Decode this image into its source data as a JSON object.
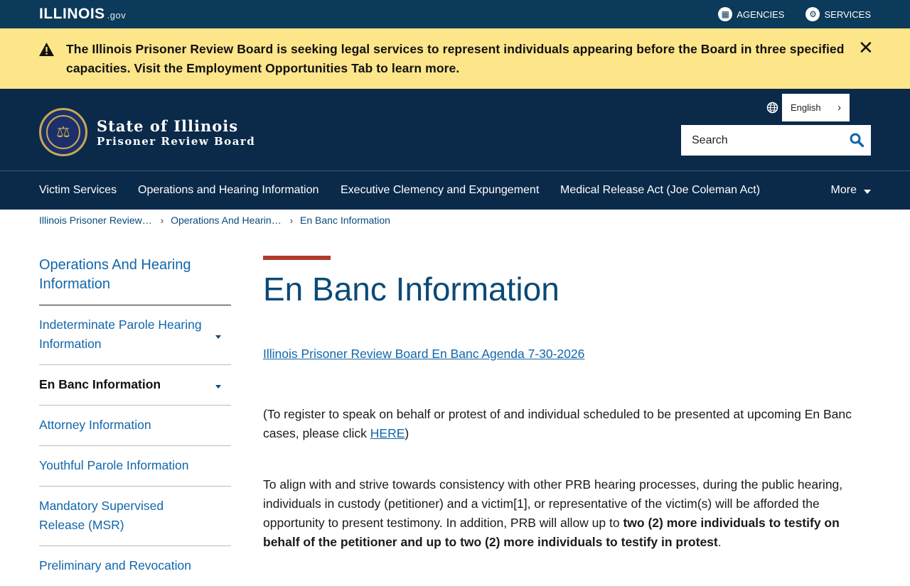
{
  "gov_bar": {
    "logo_text": "ILLINOIS",
    "logo_suffix": ".gov",
    "agencies_label": "AGENCIES",
    "services_label": "SERVICES"
  },
  "alert": {
    "message": "The Illinois Prisoner Review Board is seeking legal services to represent individuals appearing before the Board in three specified capacities.  Visit the Employment Opportunities Tab to learn more.",
    "close_glyph": "✕"
  },
  "header": {
    "brand_line1": "State of Illinois",
    "brand_line2": "Prisoner Review Board",
    "language": "English",
    "search_placeholder": "Search"
  },
  "nav": {
    "items": [
      "Victim Services",
      "Operations and Hearing Information",
      "Executive Clemency and Expungement",
      "Medical Release Act (Joe Coleman Act)"
    ],
    "more_label": "More"
  },
  "breadcrumb": [
    "Illinois Prisoner Review…",
    "Operations And Hearin…",
    "En Banc Information"
  ],
  "sidebar": {
    "heading": "Operations And Hearing Information",
    "items": [
      {
        "label": "Indeterminate Parole Hearing Information",
        "expandable": true
      },
      {
        "label": "En Banc Information",
        "expandable": true,
        "active": true
      },
      {
        "label": "Attorney Information"
      },
      {
        "label": "Youthful Parole Information"
      },
      {
        "label": "Mandatory Supervised Release (MSR)"
      },
      {
        "label": "Preliminary and Revocation"
      }
    ]
  },
  "main": {
    "title": "En Banc Information",
    "agenda_link": "Illinois Prisoner Review Board En Banc Agenda 7-30-2026",
    "register_text": "(To register to speak on behalf or protest of and individual scheduled to be presented at upcoming En Banc cases, please click ",
    "register_link": "HERE",
    "register_close": ")",
    "para2_plain": "To align with and strive towards consistency with other PRB hearing processes, during the public hearing, individuals in custody (petitioner) and a victim[1], or representative of the victim(s) will be afforded the opportunity to present testimony.  In addition, PRB will allow up to ",
    "para2_bold": "two (2) more individuals to testify on behalf of the petitioner and up to two (2) more individuals to testify in protest",
    "para2_end": "."
  },
  "colors": {
    "gov_bar": "#0b3a5a",
    "alert_bg": "#fde58a",
    "header_bg": "#0b2a4a",
    "link": "#1166aa",
    "title": "#0b4a78",
    "accent_red": "#b23a2d"
  }
}
